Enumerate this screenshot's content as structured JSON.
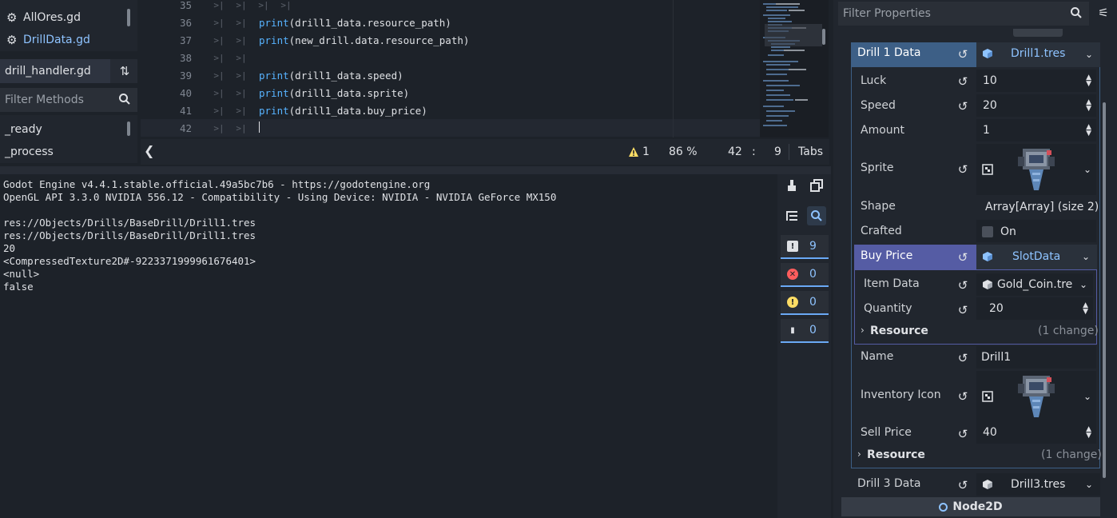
{
  "script_list": {
    "items": [
      {
        "name": "AllOres.gd",
        "active": false
      },
      {
        "name": "DrillData.gd",
        "active": true
      }
    ]
  },
  "method_panel": {
    "current_script": "drill_handler.gd",
    "filter_placeholder": "Filter Methods",
    "methods": [
      "_ready",
      "_process"
    ]
  },
  "editor": {
    "lines": [
      {
        "num": "35",
        "code": ""
      },
      {
        "num": "36",
        "fn": "print",
        "args": "(drill1_data.resource_path)"
      },
      {
        "num": "37",
        "fn": "print",
        "args": "(new_drill.data.resource_path)"
      },
      {
        "num": "38",
        "code": ""
      },
      {
        "num": "39",
        "fn": "print",
        "args": "(drill1_data.speed)"
      },
      {
        "num": "40",
        "fn": "print",
        "args": "(drill1_data.sprite)"
      },
      {
        "num": "41",
        "fn": "print",
        "args": "(drill1_data.buy_price)"
      },
      {
        "num": "42",
        "code": ""
      }
    ],
    "status": {
      "back": "❮",
      "warnings": "1",
      "zoom": "86 %",
      "line": "42",
      "sep": ":",
      "col": "9",
      "indent": "Tabs"
    }
  },
  "output": {
    "lines": [
      "Godot Engine v4.4.1.stable.official.49a5bc7b6 - https://godotengine.org",
      "OpenGL API 3.3.0 NVIDIA 556.12 - Compatibility - Using Device: NVIDIA - NVIDIA GeForce MX150",
      "",
      "res://Objects/Drills/BaseDrill/Drill1.tres",
      "res://Objects/Drills/BaseDrill/Drill1.tres",
      "20",
      "<CompressedTexture2D#-9223371999961676401>",
      "<null>",
      "false"
    ],
    "filters": {
      "messages": "9",
      "errors": "0",
      "warnings": "0",
      "editor": "0"
    },
    "colors": {
      "error": "#ff5d5d",
      "warning": "#ffdd65",
      "info": "#dfe1e5"
    }
  },
  "inspector": {
    "filter_placeholder": "Filter Properties",
    "drill1": {
      "label": "Drill 1 Data",
      "resource": "Drill1.tres",
      "luck_label": "Luck",
      "luck": "10",
      "speed_label": "Speed",
      "speed": "20",
      "amount_label": "Amount",
      "amount": "1",
      "sprite_label": "Sprite",
      "shape_label": "Shape",
      "shape": "Array[Array] (size 2)",
      "crafted_label": "Crafted",
      "crafted": "On",
      "buy_price_label": "Buy Price",
      "buy_price_resource": "SlotData",
      "item_data_label": "Item Data",
      "item_data": "Gold_Coin.tre",
      "quantity_label": "Quantity",
      "quantity": "20",
      "sub_resource_label": "Resource",
      "sub_resource_changes": "(1 change)",
      "name_label": "Name",
      "name": "Drill1",
      "inventory_icon_label": "Inventory Icon",
      "sell_price_label": "Sell Price",
      "sell_price": "40",
      "resource_label": "Resource",
      "resource_changes": "(1 change)"
    },
    "drill3": {
      "label": "Drill 3 Data",
      "resource": "Drill3.tres"
    },
    "node_bar": "Node2D",
    "colors": {
      "section_active": "#3d5f86",
      "section_buy": "#555ca4",
      "accent": "#8ec3ff"
    }
  }
}
